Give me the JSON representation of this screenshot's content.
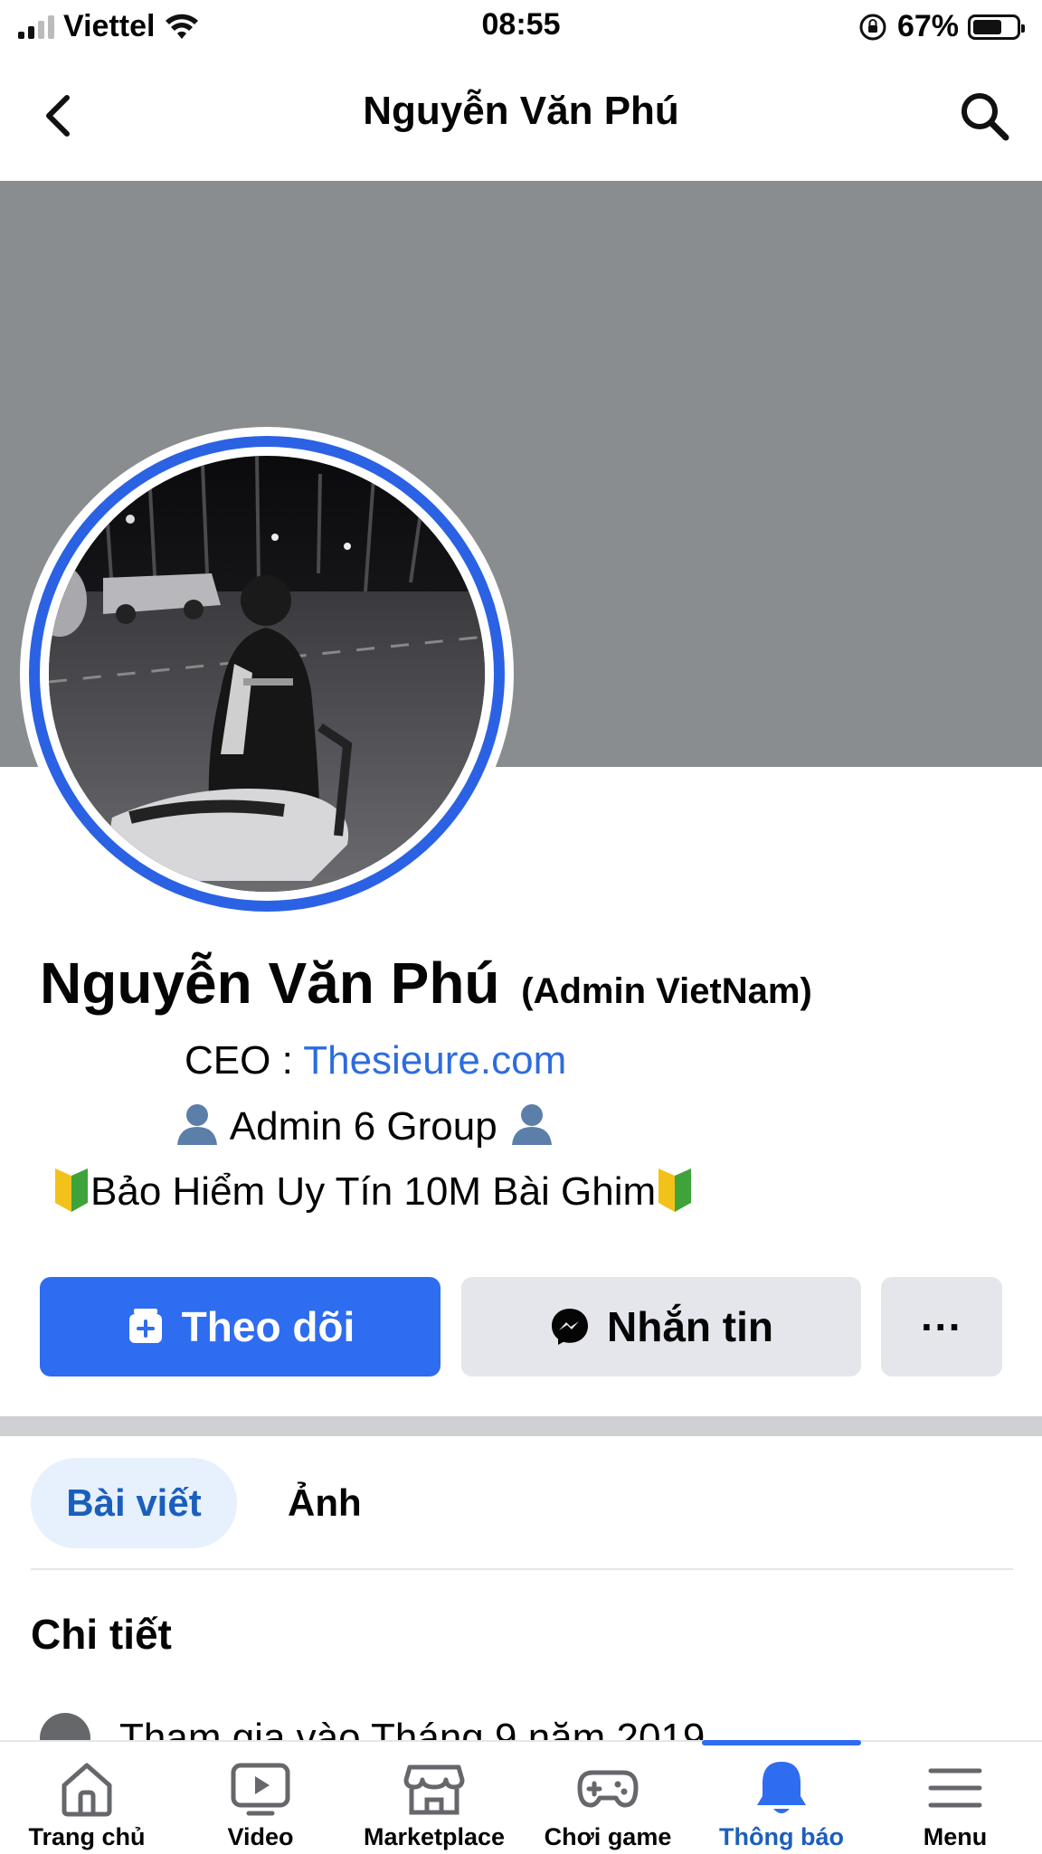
{
  "status_bar": {
    "carrier": "Viettel",
    "time": "08:55",
    "battery_percent": "67%",
    "battery_level": 0.67
  },
  "header": {
    "title": "Nguyễn Văn Phú"
  },
  "profile": {
    "name": "Nguyễn Văn Phú",
    "name_suffix": "(Admin VietNam)",
    "bio": {
      "ceo_label": "CEO : ",
      "ceo_link": "Thesieure.com",
      "admin_text": " Admin 6 Group ",
      "insurance_text": "Bảo Hiểm Uy Tín 10M Bài Ghim"
    }
  },
  "actions": {
    "follow": "Theo dõi",
    "message": "Nhắn tin",
    "more": "···"
  },
  "tabs": [
    {
      "label": "Bài viết",
      "active": true
    },
    {
      "label": "Ảnh",
      "active": false
    }
  ],
  "details": {
    "title": "Chi tiết",
    "joined": "Tham gia vào Tháng 9 năm 2019"
  },
  "bottom_nav": [
    {
      "label": "Trang chủ",
      "icon": "home-icon"
    },
    {
      "label": "Video",
      "icon": "video-icon"
    },
    {
      "label": "Marketplace",
      "icon": "marketplace-icon"
    },
    {
      "label": "Chơi game",
      "icon": "gamepad-icon"
    },
    {
      "label": "Thông báo",
      "icon": "bell-icon",
      "active": true
    },
    {
      "label": "Menu",
      "icon": "menu-icon"
    }
  ],
  "colors": {
    "accent": "#2e6cf0",
    "cover": "#898d90",
    "link": "#2d6cdf",
    "active_tab_bg": "#e7f0fd"
  }
}
